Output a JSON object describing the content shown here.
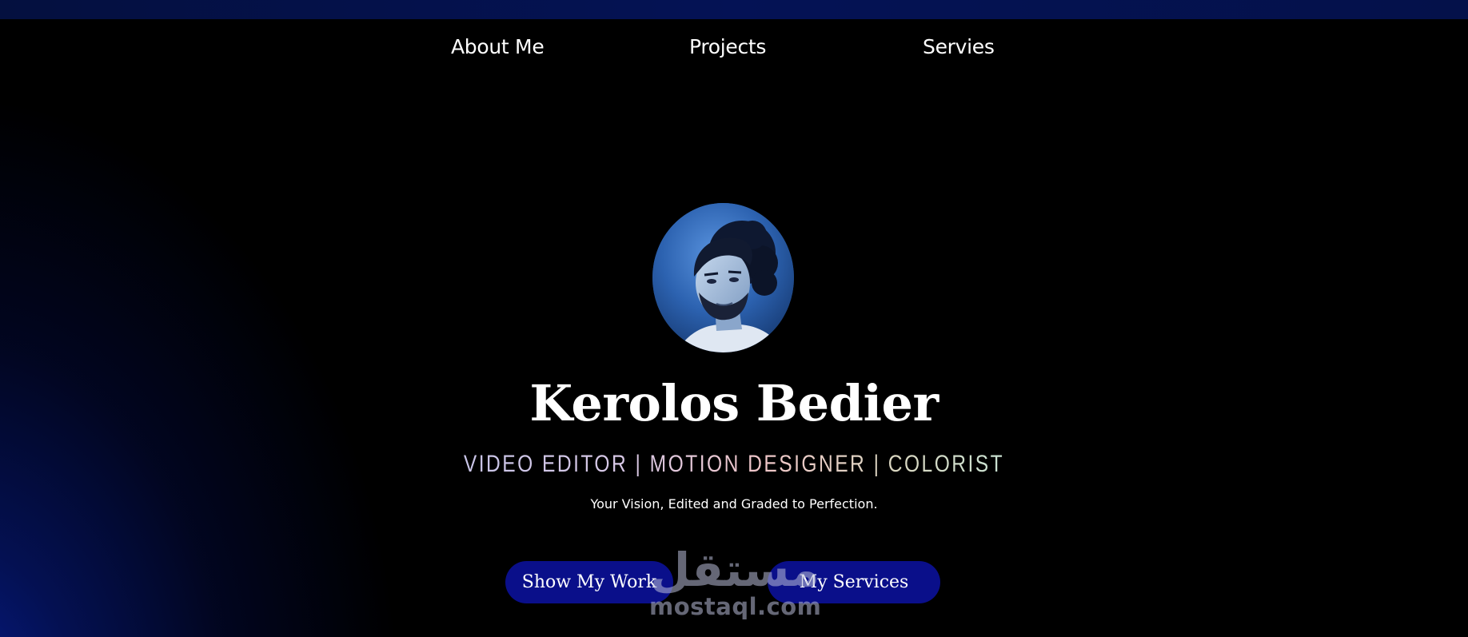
{
  "nav": {
    "items": [
      {
        "label": "About Me"
      },
      {
        "label": "Projects"
      },
      {
        "label": "Servies"
      }
    ]
  },
  "hero": {
    "name": "Kerolos Bedier",
    "roles": "VIDEO EDITOR | MOTION DESIGNER | COLORIST",
    "tagline": "Your Vision, Edited and Graded to Perfection.",
    "primary_button": "Show My Work",
    "secondary_button": "My Services"
  },
  "watermark": {
    "logo": "مستقل",
    "text": "mostaql.com"
  },
  "colors": {
    "background": "#000000",
    "accent_glow": "#081e96",
    "button": "#0a0f8a",
    "text": "#ffffff"
  }
}
